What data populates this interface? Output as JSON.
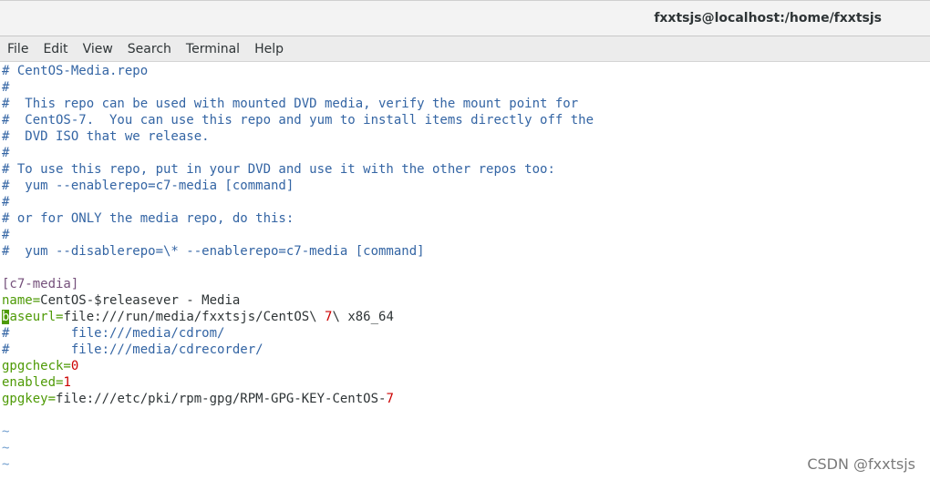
{
  "window": {
    "title": "fxxtsjs@localhost:/home/fxxtsjs"
  },
  "menu": {
    "items": [
      "File",
      "Edit",
      "View",
      "Search",
      "Terminal",
      "Help"
    ]
  },
  "editor": {
    "comments": [
      "# CentOS-Media.repo",
      "#",
      "#  This repo can be used with mounted DVD media, verify the mount point for",
      "#  CentOS-7.  You can use this repo and yum to install items directly off the",
      "#  DVD ISO that we release.",
      "#",
      "# To use this repo, put in your DVD and use it with the other repos too:",
      "#  yum --enablerepo=c7-media [command]",
      "#",
      "# or for ONLY the media repo, do this:",
      "#",
      "#  yum --disablerepo=\\* --enablerepo=c7-media [command]"
    ],
    "section": "[c7-media]",
    "name_key": "name=",
    "name_value": "CentOS-$releasever - Media",
    "baseurl_cursor_char": "b",
    "baseurl_key_rest": "aseurl=",
    "baseurl_value_a": "file:///run/media/fxxtsjs/CentOS\\ ",
    "baseurl_value_num": "7",
    "baseurl_value_b": "\\ x86_64",
    "commented_urls": [
      "#        file:///media/cdrom/",
      "#        file:///media/cdrecorder/"
    ],
    "gpgcheck_key": "gpgcheck=",
    "gpgcheck_value": "0",
    "enabled_key": "enabled=",
    "enabled_value": "1",
    "gpgkey_key": "gpgkey=",
    "gpgkey_value": "file:///etc/pki/rpm-gpg/RPM-GPG-KEY-CentOS-",
    "gpgkey_num": "7",
    "tildes": [
      "~",
      "~",
      "~"
    ]
  },
  "watermark": "CSDN @fxxtsjs",
  "colors": {
    "comment": "#3465a4",
    "section": "#75507b",
    "key": "#4e9a06",
    "number": "#cc0000",
    "text": "#2e3436",
    "tilde": "#729fcf"
  }
}
